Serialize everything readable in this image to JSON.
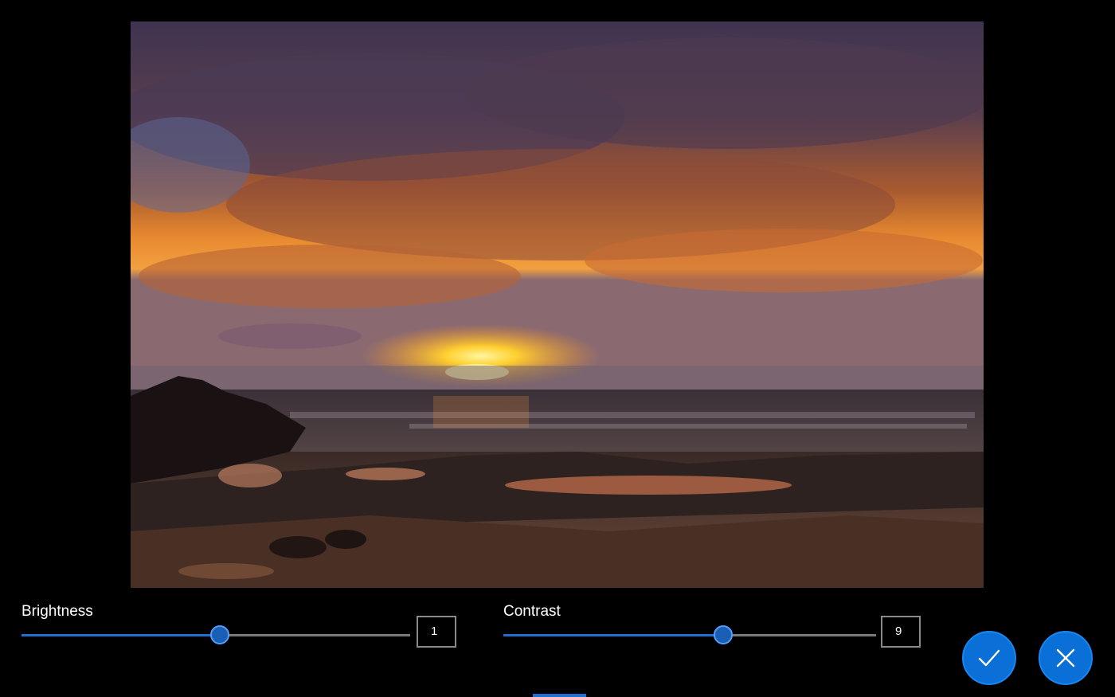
{
  "brightness": {
    "label": "Brightness",
    "value": "1",
    "fraction": 0.51
  },
  "contrast": {
    "label": "Contrast",
    "value": "9",
    "fraction": 0.59
  },
  "actions": {
    "confirm_icon": "checkmark-icon",
    "cancel_icon": "close-icon"
  },
  "colors": {
    "accent": "#0a6fd6",
    "track": "#7a7a7a",
    "background": "#000000"
  }
}
